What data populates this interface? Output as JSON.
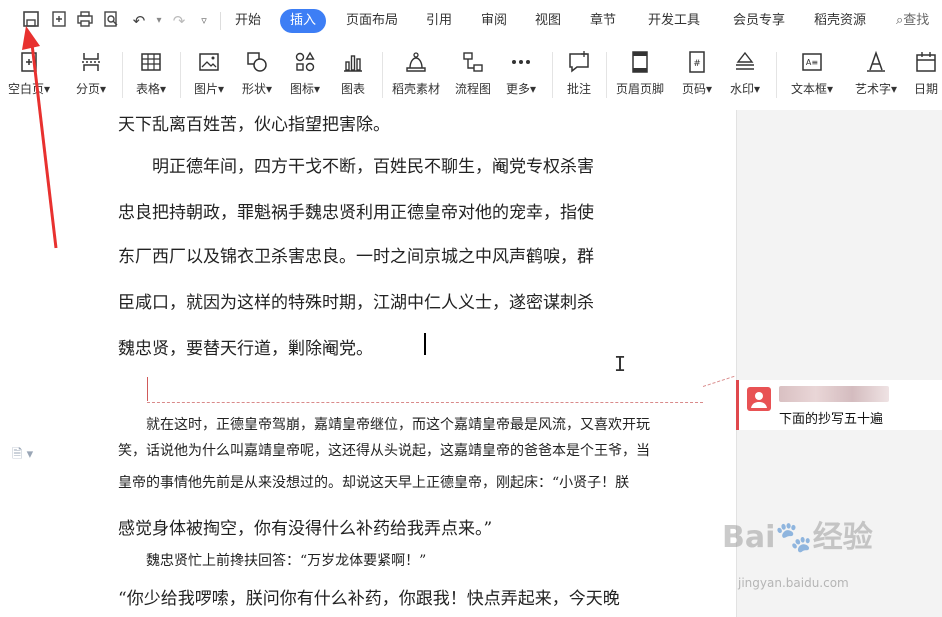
{
  "quick_access": {
    "save_icon": "save-icon",
    "items": [
      "save-icon",
      "export-pdf-icon",
      "print-icon",
      "print-preview-icon",
      "undo-icon",
      "redo-icon",
      "more-icon"
    ]
  },
  "tabs": [
    {
      "label": "开始",
      "active": false
    },
    {
      "label": "插入",
      "active": true
    },
    {
      "label": "页面布局",
      "active": false
    },
    {
      "label": "引用",
      "active": false
    },
    {
      "label": "审阅",
      "active": false
    },
    {
      "label": "视图",
      "active": false
    },
    {
      "label": "章节",
      "active": false
    },
    {
      "label": "开发工具",
      "active": false
    },
    {
      "label": "会员专享",
      "active": false
    },
    {
      "label": "稻壳资源",
      "active": false
    }
  ],
  "search_label": "查找",
  "ribbon": [
    {
      "label": "空白页",
      "icon": "blank-page-icon",
      "dropdown": true
    },
    {
      "label": "分页",
      "icon": "page-break-icon",
      "dropdown": true
    },
    {
      "label": "表格",
      "icon": "table-icon",
      "dropdown": true
    },
    {
      "label": "图片",
      "icon": "picture-icon",
      "dropdown": true
    },
    {
      "label": "形状",
      "icon": "shapes-icon",
      "dropdown": true
    },
    {
      "label": "图标",
      "icon": "icons-icon",
      "dropdown": true
    },
    {
      "label": "图表",
      "icon": "chart-icon",
      "dropdown": false
    },
    {
      "label": "稻壳素材",
      "icon": "docer-material-icon",
      "dropdown": false
    },
    {
      "label": "流程图",
      "icon": "flowchart-icon",
      "dropdown": false
    },
    {
      "label": "更多",
      "icon": "more-dots-icon",
      "dropdown": true
    },
    {
      "label": "批注",
      "icon": "comment-icon",
      "dropdown": false
    },
    {
      "label": "页眉页脚",
      "icon": "header-footer-icon",
      "dropdown": false
    },
    {
      "label": "页码",
      "icon": "page-number-icon",
      "dropdown": true
    },
    {
      "label": "水印",
      "icon": "watermark-icon",
      "dropdown": true
    },
    {
      "label": "文本框",
      "icon": "textbox-icon",
      "dropdown": true
    },
    {
      "label": "艺术字",
      "icon": "wordart-icon",
      "dropdown": true
    },
    {
      "label": "日期",
      "icon": "date-icon",
      "dropdown": false
    }
  ],
  "document": {
    "lines": [
      "天下乱离百姓苦，伙心指望把害除。",
      "　　明正德年间，四方干戈不断，百姓民不聊生，阉党专权杀害",
      "忠良把持朝政，罪魁祸手魏忠贤利用正德皇帝对他的宠幸，指使",
      "东厂西厂以及锦衣卫杀害忠良。一时之间京城之中风声鹤唳，群",
      "臣咸口，就因为这样的特殊时期，江湖中仁人义士，遂密谋刺杀",
      "魏忠贤，要替天行道，剿除阉党。"
    ],
    "lines2": [
      "　　就在这时，正德皇帝驾崩，嘉靖皇帝继位，而这个嘉靖皇帝最是风流，又喜欢开玩",
      "笑，话说他为什么叫嘉靖皇帝呢，这还得从头说起，这嘉靖皇帝的爸爸本是个王爷，当",
      "皇帝的事情他先前是从来没想过的。却说这天早上正德皇帝，刚起床：“小贤子！朕",
      "感觉身体被掏空，你有没得什么补药给我弄点来。”",
      "　　魏忠贤忙上前搀扶回答：“万岁龙体要紧啊！”",
      "“你少给我啰嗦，朕问你有什么补药，你跟我！快点弄起来，今天晚"
    ]
  },
  "comment": {
    "avatar_icon": "user-icon",
    "text": "下面的抄写五十遍"
  },
  "watermark": {
    "brand": "Bai",
    "brand2": "经验",
    "url": "jingyan.baidu.com"
  },
  "colors": {
    "accent": "#3d7ef5",
    "arrow": "#e8312f",
    "comment_bar": "#e0484d"
  }
}
